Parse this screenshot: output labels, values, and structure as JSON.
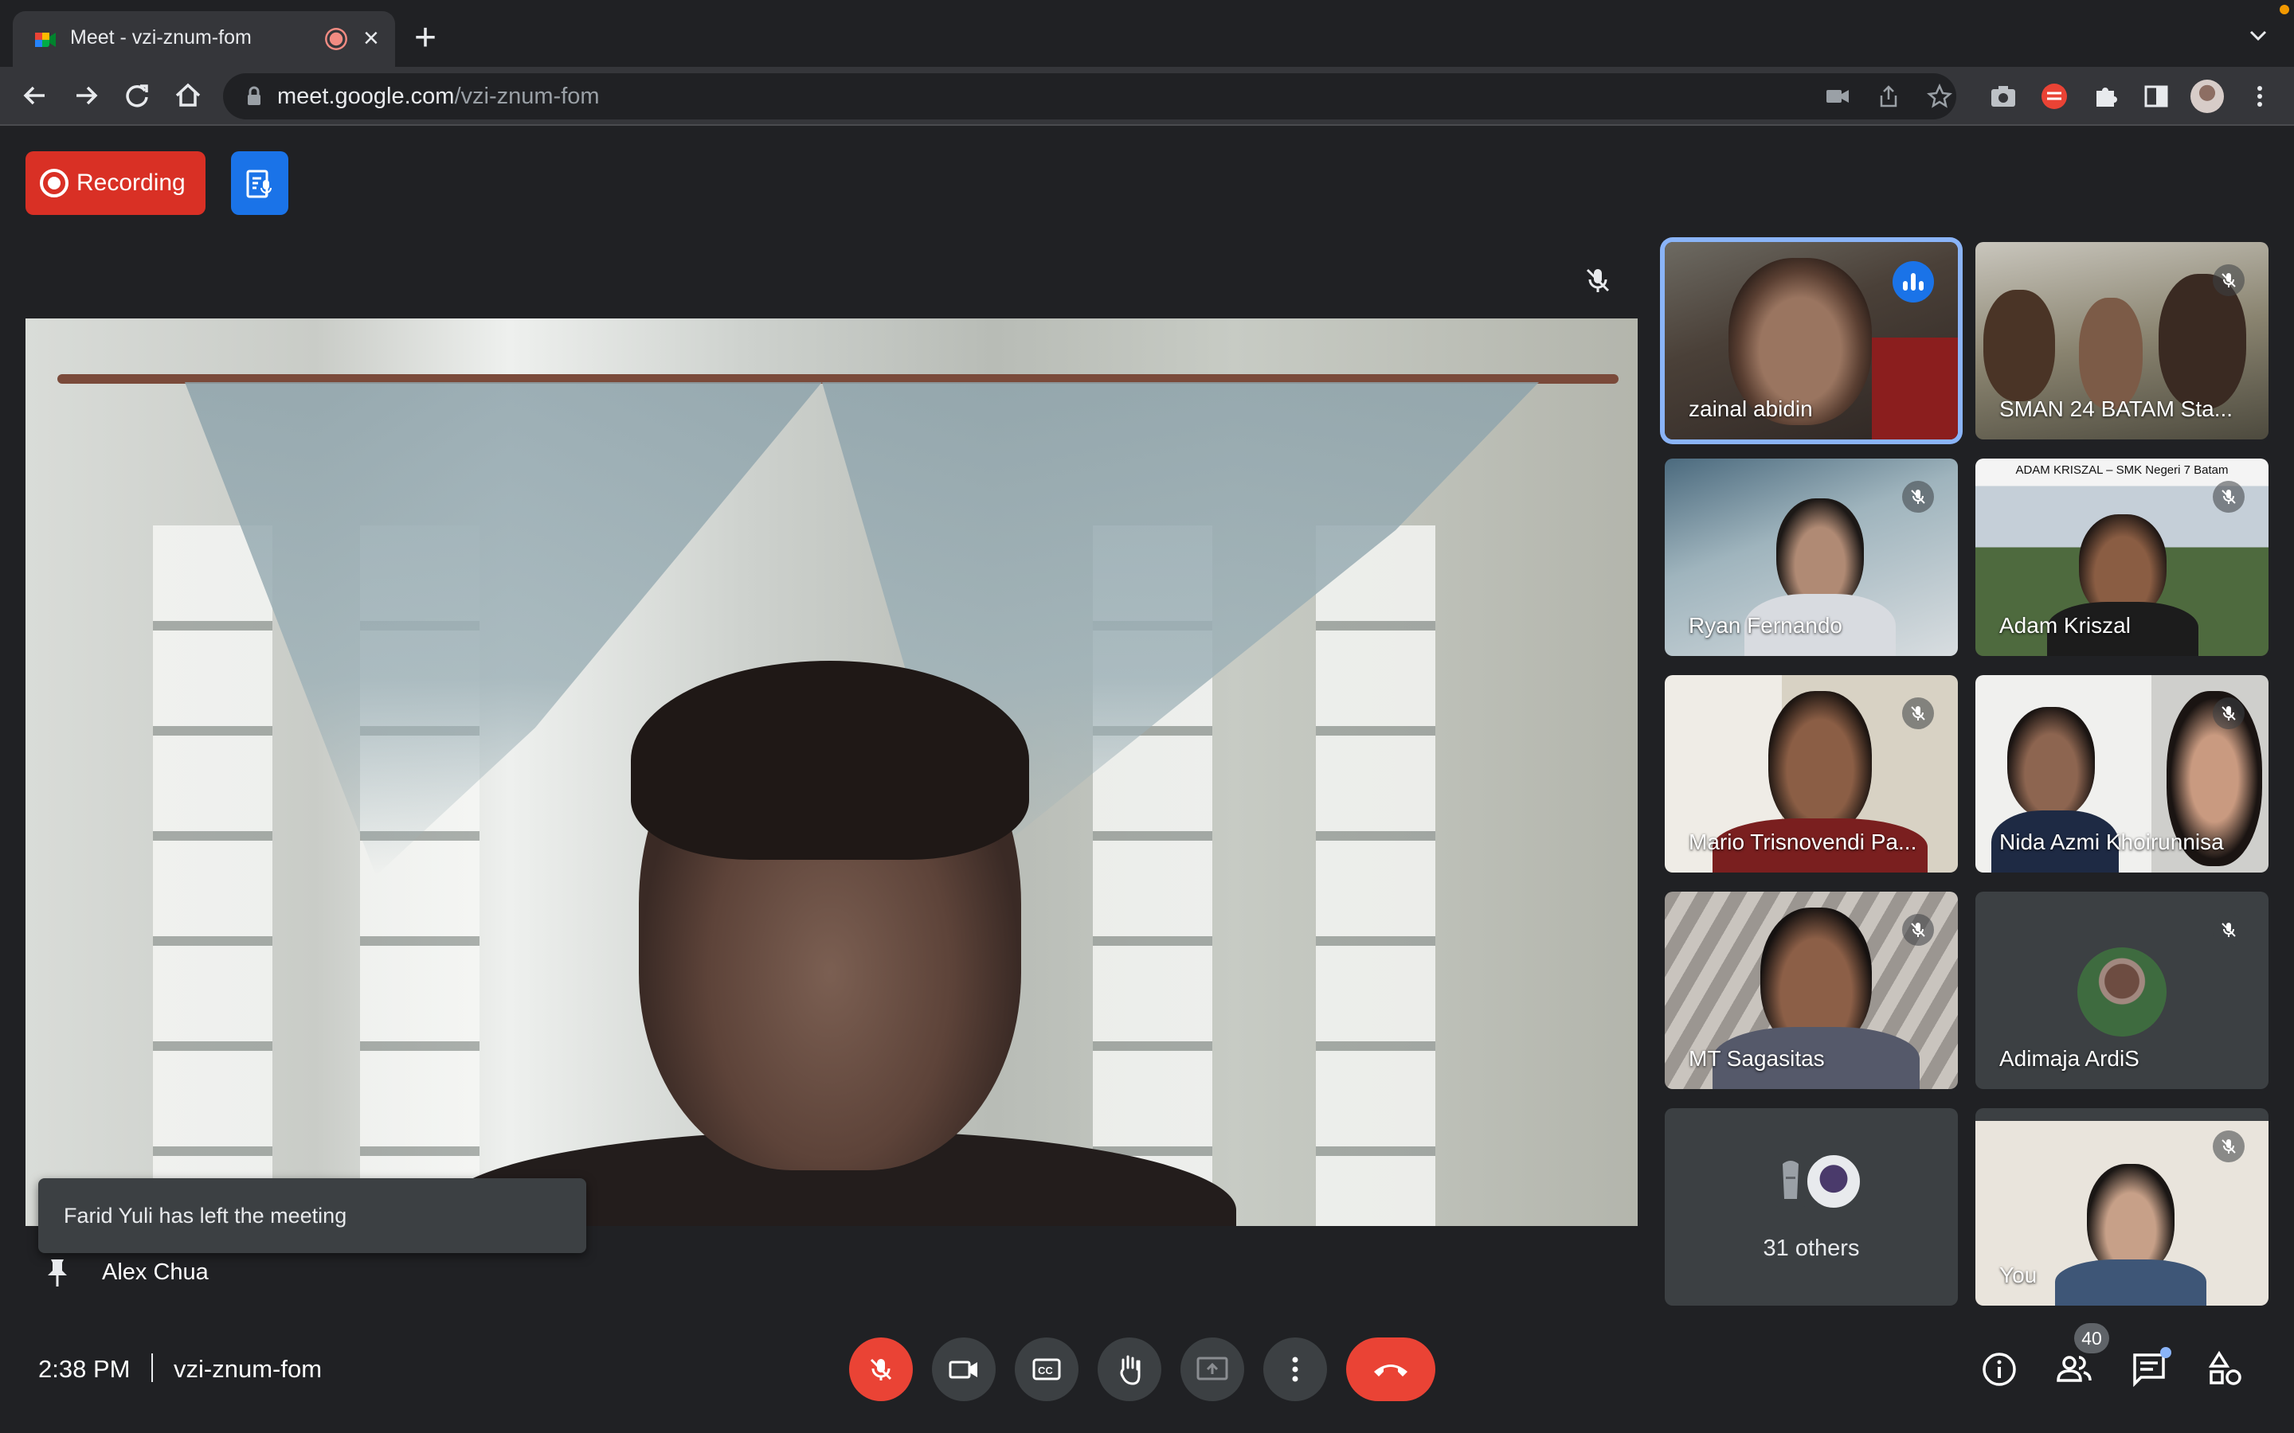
{
  "browser": {
    "tab_title": "Meet - vzi-znum-fom",
    "url_host": "meet.google.com",
    "url_path": "/vzi-znum-fom"
  },
  "meet": {
    "recording_label": "Recording",
    "main_speaker": "Alex Chua",
    "toast": "Farid Yuli has left the meeting",
    "time": "2:38 PM",
    "meeting_code": "vzi-znum-fom",
    "participant_count": "40",
    "others_label": "31 others"
  },
  "tiles": [
    {
      "name": "zainal abidin",
      "speaking": true
    },
    {
      "name": "SMAN 24 BATAM Sta...",
      "muted": true
    },
    {
      "name": "Ryan Fernando",
      "muted": true
    },
    {
      "name": "Adam Kriszal",
      "muted": true,
      "overlay_text": "ADAM KRISZAL – SMK Negeri 7 Batam"
    },
    {
      "name": "Mario Trisnovendi Pa...",
      "muted": true
    },
    {
      "name": "Nida Azmi Khoirunnisa",
      "muted": true
    },
    {
      "name": "MT Sagasitas",
      "muted": true
    },
    {
      "name": "Adimaja ArdiS",
      "muted": true
    },
    {
      "name": "You",
      "muted": true
    }
  ],
  "colors": {
    "background": "#202124",
    "recording_red": "#d93025",
    "transcript_blue": "#1a73e8",
    "end_call_red": "#ea4335",
    "speaking_outline": "#8ab4f8"
  },
  "icons": [
    "meet-favicon-icon",
    "recording-dot-icon",
    "close-icon",
    "plus-icon",
    "back-icon",
    "forward-icon",
    "reload-icon",
    "home-icon",
    "lock-icon",
    "camera-icon",
    "share-icon",
    "star-icon",
    "screenshot-icon",
    "extension-icon",
    "puzzle-icon",
    "sidepanel-icon",
    "kebab-icon",
    "transcript-icon",
    "mic-off-icon",
    "pin-icon",
    "videocam-icon",
    "captions-icon",
    "raise-hand-icon",
    "present-icon",
    "more-icon",
    "call-end-icon",
    "info-icon",
    "people-icon",
    "chat-icon",
    "activities-icon"
  ]
}
